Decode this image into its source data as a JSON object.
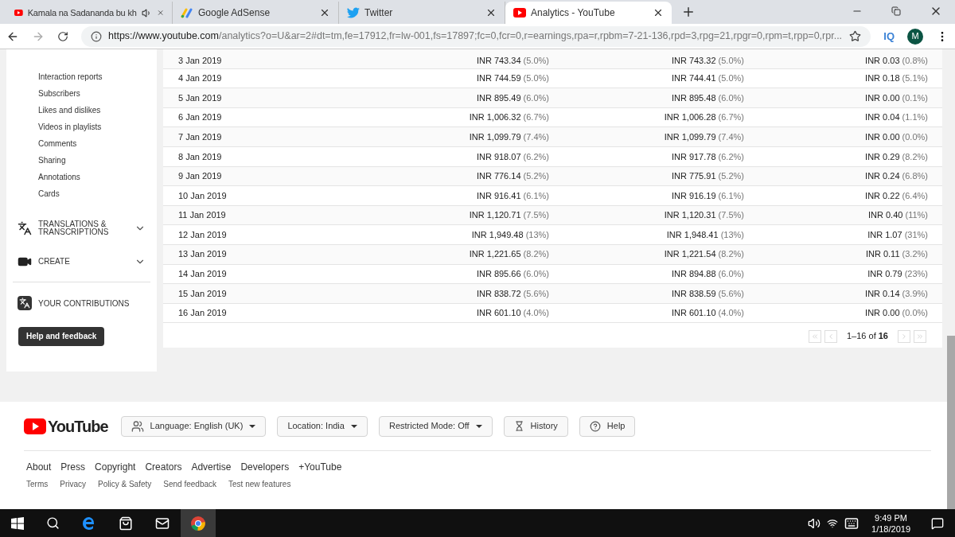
{
  "browser": {
    "tabs": [
      {
        "title": "Kamala na Sadananda bu kh",
        "kind": "youtube",
        "audio": true,
        "selected": false
      },
      {
        "title": "Google AdSense",
        "kind": "adsense",
        "audio": false,
        "selected": false
      },
      {
        "title": "Twitter",
        "kind": "twitter",
        "audio": false,
        "selected": false
      },
      {
        "title": "Analytics - YouTube",
        "kind": "youtube",
        "audio": false,
        "selected": true
      }
    ],
    "url_host": "https://www.youtube.com",
    "url_path": "/analytics?o=U&ar=2#dt=tm,fe=17912,fr=lw-001,fs=17897;fc=0,fcr=0,r=earnings,rpa=r,rpbm=7-21-136,rpd=3,rpg=21,rpgr=0,rpm=t,rpp=0,rpr...",
    "extension": "IQ",
    "avatar": "M"
  },
  "sidebar": {
    "items": [
      "Interaction reports",
      "Subscribers",
      "Likes and dislikes",
      "Videos in playlists",
      "Comments",
      "Sharing",
      "Annotations",
      "Cards"
    ],
    "sections": [
      {
        "kind": "translate",
        "label": "TRANSLATIONS & TRANSCRIPTIONS",
        "expanded": false
      },
      {
        "kind": "create",
        "label": "CREATE",
        "expanded": false
      }
    ],
    "contributions": "YOUR CONTRIBUTIONS",
    "help_button": "Help and feedback"
  },
  "table": {
    "rows": [
      {
        "date": "3 Jan 2019",
        "c2": [
          "INR 743.34",
          "(5.0%)"
        ],
        "c3": [
          "INR 743.32",
          "(5.0%)"
        ],
        "c4": [
          "INR 0.03",
          "(0.8%)"
        ]
      },
      {
        "date": "4 Jan 2019",
        "c2": [
          "INR 744.59",
          "(5.0%)"
        ],
        "c3": [
          "INR 744.41",
          "(5.0%)"
        ],
        "c4": [
          "INR 0.18",
          "(5.1%)"
        ]
      },
      {
        "date": "5 Jan 2019",
        "c2": [
          "INR 895.49",
          "(6.0%)"
        ],
        "c3": [
          "INR 895.48",
          "(6.0%)"
        ],
        "c4": [
          "INR 0.00",
          "(0.1%)"
        ]
      },
      {
        "date": "6 Jan 2019",
        "c2": [
          "INR 1,006.32",
          "(6.7%)"
        ],
        "c3": [
          "INR 1,006.28",
          "(6.7%)"
        ],
        "c4": [
          "INR 0.04",
          "(1.1%)"
        ]
      },
      {
        "date": "7 Jan 2019",
        "c2": [
          "INR 1,099.79",
          "(7.4%)"
        ],
        "c3": [
          "INR 1,099.79",
          "(7.4%)"
        ],
        "c4": [
          "INR 0.00",
          "(0.0%)"
        ]
      },
      {
        "date": "8 Jan 2019",
        "c2": [
          "INR 918.07",
          "(6.2%)"
        ],
        "c3": [
          "INR 917.78",
          "(6.2%)"
        ],
        "c4": [
          "INR 0.29",
          "(8.2%)"
        ]
      },
      {
        "date": "9 Jan 2019",
        "c2": [
          "INR 776.14",
          "(5.2%)"
        ],
        "c3": [
          "INR 775.91",
          "(5.2%)"
        ],
        "c4": [
          "INR 0.24",
          "(6.8%)"
        ]
      },
      {
        "date": "10 Jan 2019",
        "c2": [
          "INR 916.41",
          "(6.1%)"
        ],
        "c3": [
          "INR 916.19",
          "(6.1%)"
        ],
        "c4": [
          "INR 0.22",
          "(6.4%)"
        ]
      },
      {
        "date": "11 Jan 2019",
        "c2": [
          "INR 1,120.71",
          "(7.5%)"
        ],
        "c3": [
          "INR 1,120.31",
          "(7.5%)"
        ],
        "c4": [
          "INR 0.40",
          "(11%)"
        ]
      },
      {
        "date": "12 Jan 2019",
        "c2": [
          "INR 1,949.48",
          "(13%)"
        ],
        "c3": [
          "INR 1,948.41",
          "(13%)"
        ],
        "c4": [
          "INR 1.07",
          "(31%)"
        ]
      },
      {
        "date": "13 Jan 2019",
        "c2": [
          "INR 1,221.65",
          "(8.2%)"
        ],
        "c3": [
          "INR 1,221.54",
          "(8.2%)"
        ],
        "c4": [
          "INR 0.11",
          "(3.2%)"
        ]
      },
      {
        "date": "14 Jan 2019",
        "c2": [
          "INR 895.66",
          "(6.0%)"
        ],
        "c3": [
          "INR 894.88",
          "(6.0%)"
        ],
        "c4": [
          "INR 0.79",
          "(23%)"
        ]
      },
      {
        "date": "15 Jan 2019",
        "c2": [
          "INR 838.72",
          "(5.6%)"
        ],
        "c3": [
          "INR 838.59",
          "(5.6%)"
        ],
        "c4": [
          "INR 0.14",
          "(3.9%)"
        ]
      },
      {
        "date": "16 Jan 2019",
        "c2": [
          "INR 601.10",
          "(4.0%)"
        ],
        "c3": [
          "INR 601.10",
          "(4.0%)"
        ],
        "c4": [
          "INR 0.00",
          "(0.0%)"
        ]
      }
    ],
    "pagination": {
      "range": "1–16 of",
      "total": "16"
    }
  },
  "footer": {
    "logo": "YouTube",
    "controls": [
      {
        "kind": "language",
        "label": "Language: English (UK)"
      },
      {
        "kind": "dropdown",
        "label": "Location: India"
      },
      {
        "kind": "dropdown",
        "label": "Restricted Mode: Off"
      },
      {
        "kind": "history",
        "label": "History"
      },
      {
        "kind": "help",
        "label": "Help"
      }
    ],
    "links": [
      "About",
      "Press",
      "Copyright",
      "Creators",
      "Advertise",
      "Developers",
      "+YouTube"
    ],
    "small_links": [
      "Terms",
      "Privacy",
      "Policy & Safety",
      "Send feedback",
      "Test new features"
    ]
  },
  "taskbar": {
    "time": "9:49 PM",
    "date": "1/18/2019"
  }
}
